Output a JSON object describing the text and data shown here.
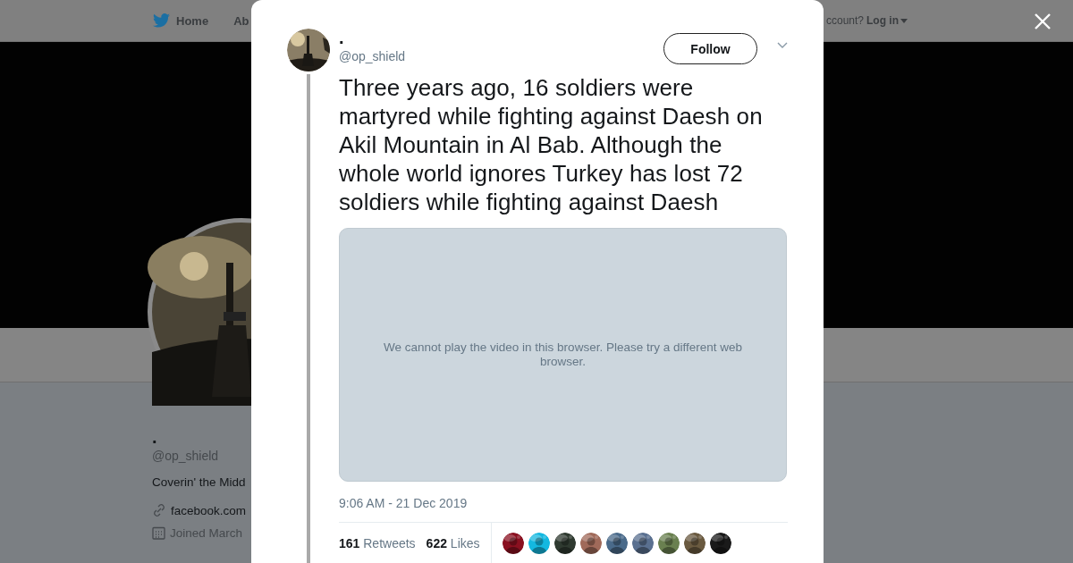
{
  "top_nav": {
    "items": [
      {
        "label": "Home"
      },
      {
        "label": "Ab"
      }
    ],
    "account_prompt": "ccount?",
    "login": "Log in"
  },
  "profile": {
    "name": ".",
    "handle": "@op_shield",
    "bio": "Coverin' the Midd",
    "link": "facebook.com",
    "joined": "Joined March"
  },
  "tweet_modal": {
    "author": {
      "name": ".",
      "handle": "@op_shield"
    },
    "follow_button": "Follow",
    "text": "Three years ago, 16 soldiers were martyred while fighting against Daesh on Akil Mountain in Al Bab. Although the whole world ignores Turkey has lost 72 soldiers while fighting against Daesh",
    "video": {
      "message": "We cannot play the video in this browser. Please try a different web browser."
    },
    "timestamp": "9:06 AM - 21 Dec 2019",
    "stats": [
      {
        "count": "161",
        "label": "Retweets"
      },
      {
        "count": "622",
        "label": "Likes"
      }
    ],
    "likers": [
      {
        "color": "#8a1020"
      },
      {
        "color": "#14b8e0"
      },
      {
        "color": "#2f3a30"
      },
      {
        "color": "#a06a5a"
      },
      {
        "color": "#4a6a8a"
      },
      {
        "color": "#5a7090"
      },
      {
        "color": "#6a8050"
      },
      {
        "color": "#6a5a40"
      },
      {
        "color": "#1a1a1a"
      }
    ]
  }
}
